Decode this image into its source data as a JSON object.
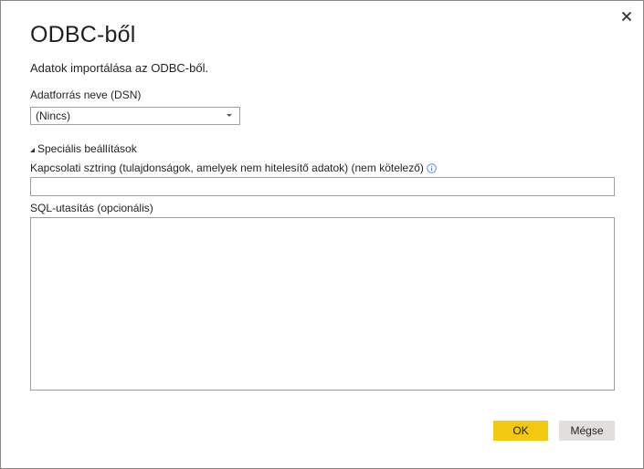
{
  "dialog": {
    "title": "ODBC-ből",
    "subtitle": "Adatok importálása az ODBC-ből."
  },
  "dsn": {
    "label": "Adatforrás neve (DSN)",
    "selected": "(Nincs)"
  },
  "advanced": {
    "toggle_label": "Speciális beállítások",
    "connection_string": {
      "label": "Kapcsolati sztring (tulajdonságok, amelyek nem hitelesítő adatok) (nem kötelező)",
      "value": "",
      "info_icon": "info-icon"
    },
    "sql": {
      "label": "SQL-utasítás (opcionális)",
      "value": ""
    }
  },
  "buttons": {
    "ok": "OK",
    "cancel": "Mégse"
  },
  "icons": {
    "close": "close-icon",
    "dropdown": "chevron-down-icon",
    "expand": "triangle-expanded-icon"
  },
  "colors": {
    "primary_button": "#f2c811",
    "secondary_button": "#e1dfdd",
    "border": "#a19f9d",
    "info": "#4a7fd1"
  }
}
